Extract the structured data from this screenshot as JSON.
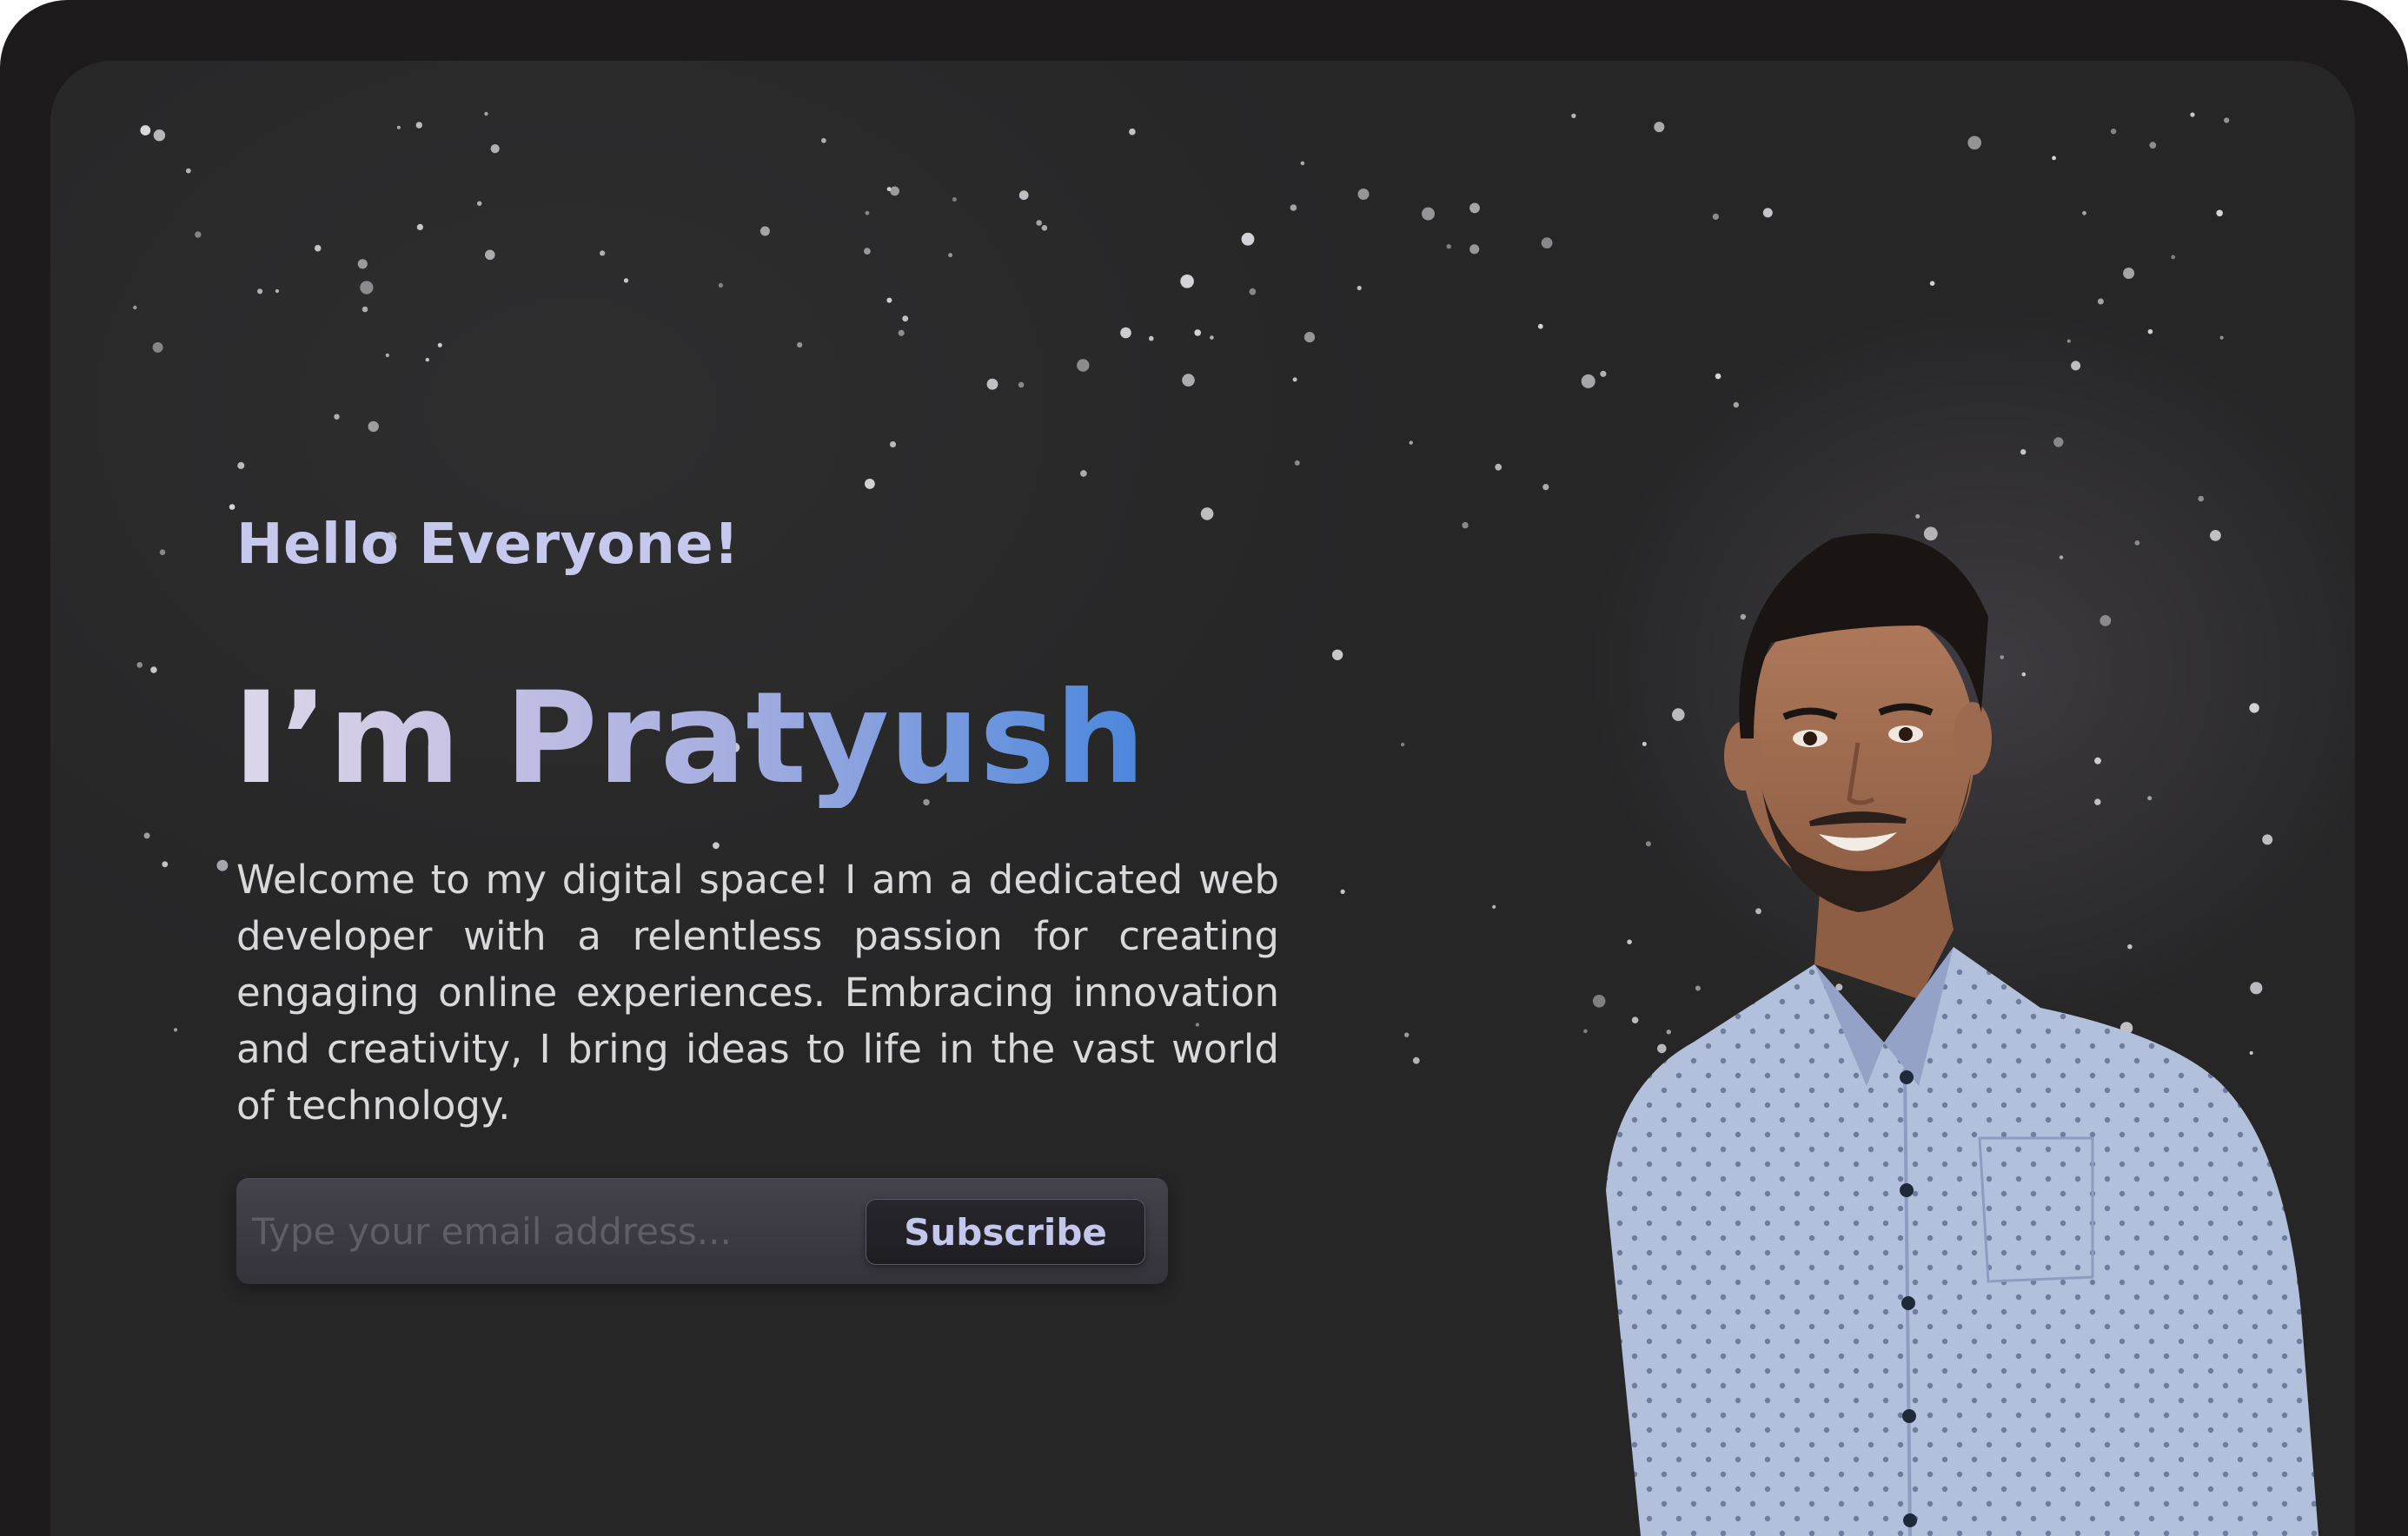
{
  "hero": {
    "greeting": "Hello Everyone!",
    "headline": "I’m Pratyush",
    "bio": "Welcome to my digital space! I am a dedicated web developer with a relentless passion for creating engaging online experiences. Embracing innovation and creativity, I bring ideas to life in the vast world of technology."
  },
  "subscribe": {
    "placeholder": "Type your email address...",
    "button_label": "Subscribe"
  },
  "colors": {
    "background": "#2a2a2b",
    "frame": "#1c1a1a",
    "greeting": "#c6c8ee",
    "headline_gradient_start": "#ddd8ea",
    "headline_gradient_end": "#4a86dc",
    "body_text": "#d9d9db",
    "shirt": "#aab8d6"
  },
  "icons": {
    "background_decoration": "star-field",
    "portrait": "person-photo"
  }
}
